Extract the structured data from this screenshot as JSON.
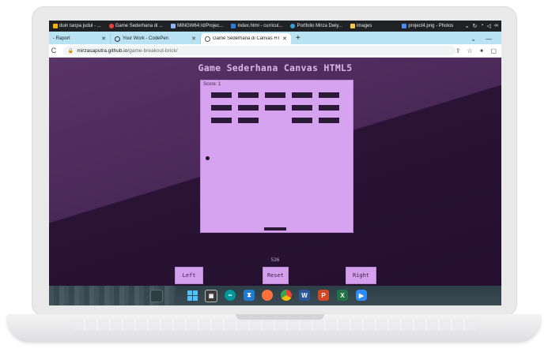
{
  "bookmarks": [
    {
      "label": "duin tanpa judul - ...",
      "color": "#f4b400"
    },
    {
      "label": "Game Sederhana di ...",
      "color": "#ea4335"
    },
    {
      "label": "MINGW64:/d/Projec...",
      "color": "#8ab4f8"
    },
    {
      "label": "index.html - curricul...",
      "color": "#2b7cd3"
    },
    {
      "label": "Portfolio Mirza Dwiy...",
      "color": "#34a0d8"
    },
    {
      "label": "images",
      "color": "#f7c948"
    },
    {
      "label": "project4.png - Photos",
      "color": "#4c8bf5"
    }
  ],
  "tabs": [
    {
      "label": "- Raport",
      "close": "✕"
    },
    {
      "label": "Your Work - CodePen",
      "close": "✕"
    },
    {
      "label": "Game Sederhana di Canvas HTML",
      "close": "✕"
    }
  ],
  "new_tab": "+",
  "address": {
    "host": "mirzasaputra.github.io",
    "path": "/game-breakout-brick/"
  },
  "game": {
    "title": "Game Sederhana Canvas HTML5",
    "score_text": "Score: 1",
    "counter": "526",
    "buttons": {
      "left": "Left",
      "reset": "Reset",
      "right": "Right"
    }
  },
  "bricks": [
    [
      1,
      1,
      1,
      1,
      1
    ],
    [
      1,
      1,
      1,
      1,
      1
    ],
    [
      1,
      1,
      0,
      1,
      1
    ]
  ],
  "colors": {
    "canvas": "#d7a3f0",
    "brick": "#2b1a38",
    "title": "#d9b6ec",
    "tab_strip": "#b9e3f3"
  },
  "taskbar_icons": [
    "windows-icon",
    "terminal-icon",
    "arduino-icon",
    "vscode-icon",
    "firefox-icon",
    "chrome-icon",
    "word-icon",
    "powerpoint-icon",
    "excel-icon",
    "zoom-icon"
  ]
}
